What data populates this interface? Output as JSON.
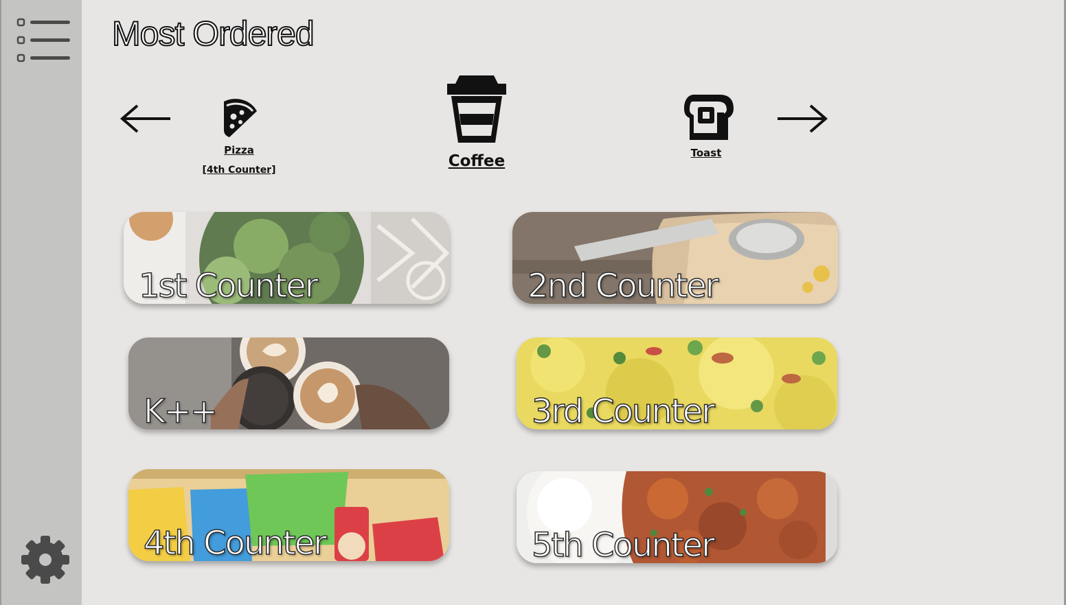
{
  "page": {
    "title": "Most Ordered"
  },
  "sidebar": {
    "menu_icon": "list-menu-icon",
    "settings_icon": "gear-icon"
  },
  "categories": {
    "prev_icon": "arrow-left-icon",
    "next_icon": "arrow-right-icon",
    "items": [
      {
        "label": "Pizza",
        "sub": "[4th Counter]",
        "icon": "pizza-icon"
      },
      {
        "label": "Coffee",
        "icon": "coffee-cup-icon",
        "selected": true
      },
      {
        "label": "Toast",
        "icon": "toast-icon"
      }
    ]
  },
  "counters": [
    {
      "label": "1st Counter",
      "image": "salad bowl photo"
    },
    {
      "label": "2nd Counter",
      "image": "spoon and plate photo"
    },
    {
      "label": "K++",
      "image": "coffee cups photo"
    },
    {
      "label": "3rd Counter",
      "image": "yellow rice photo"
    },
    {
      "label": "4th Counter",
      "image": "chips packets photo"
    },
    {
      "label": "5th Counter",
      "image": "rice and curry photo"
    }
  ],
  "colors": {
    "background": "#e8e6e4",
    "sidebar": "#c4c4c2",
    "icon_dark": "#111111",
    "sidebar_icon": "#4a4a4a"
  }
}
